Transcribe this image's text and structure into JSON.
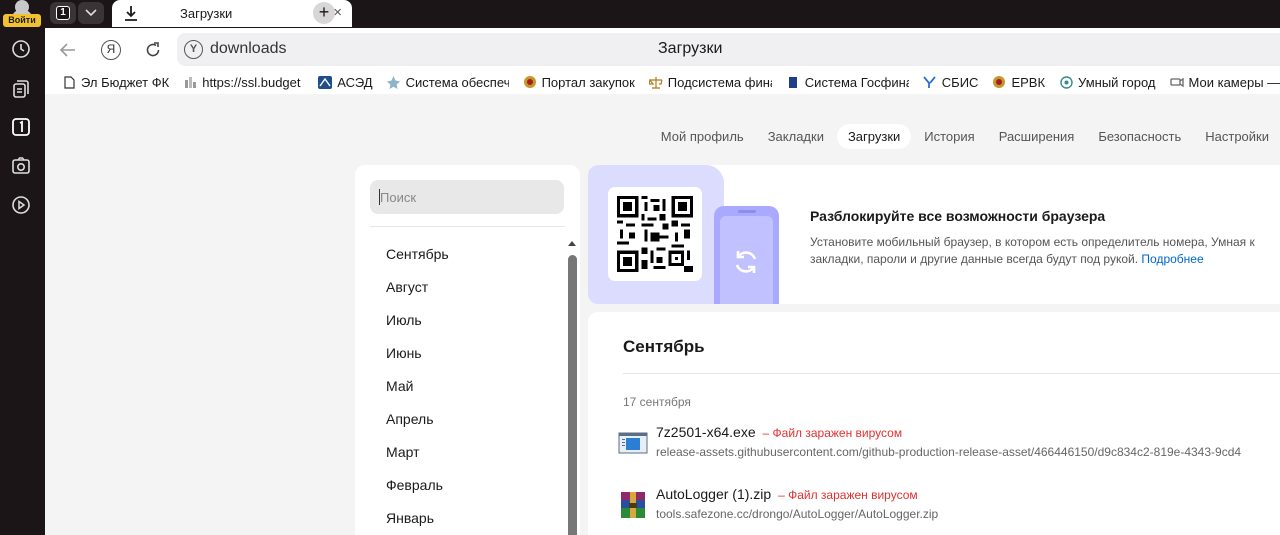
{
  "rail": {
    "login_label": "Войти"
  },
  "tabs": {
    "count_label": "1",
    "active_title": "Загрузки",
    "close_glyph": "×",
    "new_tab_glyph": "+"
  },
  "toolbar": {
    "url": "downloads",
    "page_title": "Загрузки",
    "y_button": "Я"
  },
  "bookmarks": [
    {
      "label": "Эл Бюджет ФК",
      "icon": "page-icon"
    },
    {
      "label": "https://ssl.budget",
      "icon": "site-icon"
    },
    {
      "label": "АСЭД",
      "icon": "ased-icon"
    },
    {
      "label": "Система обеспеч",
      "icon": "system-icon"
    },
    {
      "label": "Портал закупок",
      "icon": "emblem-icon"
    },
    {
      "label": "Подсистема фина",
      "icon": "scales-icon"
    },
    {
      "label": "Система Госфина",
      "icon": "gosfin-icon"
    },
    {
      "label": "СБИС",
      "icon": "sbis-icon"
    },
    {
      "label": "ЕРВК",
      "icon": "emblem-icon"
    },
    {
      "label": "Умный город",
      "icon": "smart-city-icon"
    },
    {
      "label": "Мои камеры — ка",
      "icon": "camera-icon"
    }
  ],
  "settings_nav": [
    {
      "label": "Мой профиль",
      "active": false
    },
    {
      "label": "Закладки",
      "active": false
    },
    {
      "label": "Загрузки",
      "active": true
    },
    {
      "label": "История",
      "active": false
    },
    {
      "label": "Расширения",
      "active": false
    },
    {
      "label": "Безопасность",
      "active": false
    },
    {
      "label": "Настройки",
      "active": false
    }
  ],
  "sidebar": {
    "search_placeholder": "Поиск",
    "months": [
      "Сентябрь",
      "Август",
      "Июль",
      "Июнь",
      "Май",
      "Апрель",
      "Март",
      "Февраль",
      "Январь"
    ]
  },
  "promo": {
    "title": "Разблокируйте все возможности браузера",
    "text_line1": "Установите мобильный браузер, в котором есть определитель номера, Умная к",
    "text_line2": "закладки, пароли и другие данные всегда будут под рукой.",
    "link": "Подробнее"
  },
  "downloads": {
    "month_heading": "Сентябрь",
    "date": "17 сентября",
    "items": [
      {
        "filename": "7z2501-x64.exe",
        "warning": "– Файл заражен вирусом",
        "source": "release-assets.githubusercontent.com/github-production-release-asset/466446150/d9c834c2-819e-4343-9cd4",
        "icon": "exe-icon"
      },
      {
        "filename": "AutoLogger (1).zip",
        "warning": "– Файл заражен вирусом",
        "source": "tools.safezone.cc/drongo/AutoLogger/AutoLogger.zip",
        "icon": "winrar-icon"
      }
    ]
  },
  "colors": {
    "warning": "#e03030",
    "link": "#0066cc",
    "login_badge": "#f2c12e",
    "promo_tint": "#dcdcff",
    "phone": "#a9a9ff"
  }
}
